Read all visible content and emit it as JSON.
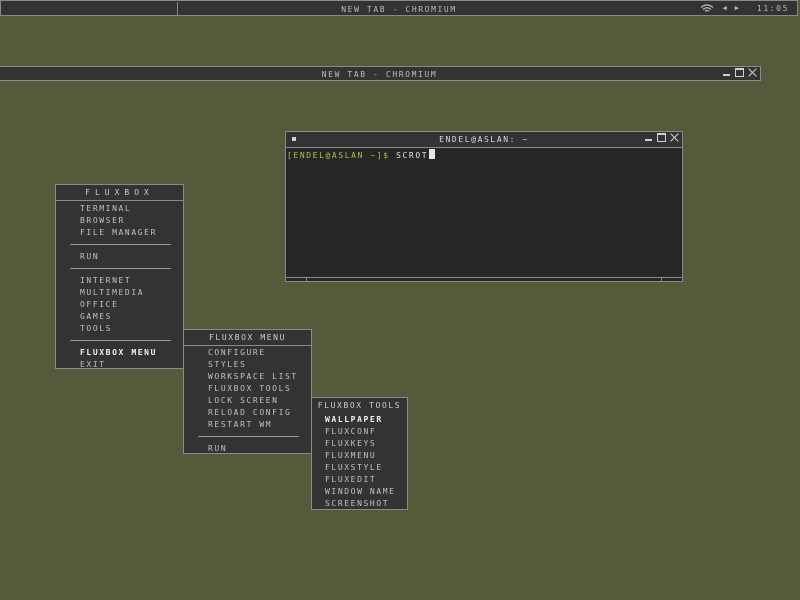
{
  "toolbar": {
    "title": "New Tab - Chromium",
    "clock": "11:05",
    "icons": [
      "wifi-icon",
      "prev-workspace-icon",
      "next-workspace-icon"
    ]
  },
  "chromium": {
    "title": "New Tab - Chromium"
  },
  "terminal": {
    "title": "endel@aslan: ~",
    "prompt": "[endel@aslan ~]$ ",
    "command": "scrot"
  },
  "main_menu": {
    "title": "Fluxbox",
    "items": [
      "Terminal",
      "Browser",
      "File Manager",
      "Run",
      "Internet",
      "Multimedia",
      "Office",
      "Games",
      "Tools",
      "Fluxbox Menu",
      "Exit"
    ]
  },
  "fluxbox_menu": {
    "title": "Fluxbox Menu",
    "items": [
      "Configure",
      "Styles",
      "Workspace List",
      "Fluxbox Tools",
      "Lock Screen",
      "Reload Config",
      "Restart WM",
      "Run"
    ]
  },
  "tools_menu": {
    "title": "Fluxbox Tools",
    "items": [
      "Wallpaper",
      "Fluxconf",
      "Fluxkeys",
      "Fluxmenu",
      "Fluxstyle",
      "Fluxedit",
      "Window Name",
      "Screenshot"
    ]
  },
  "colors": {
    "desktop": "#545a3a",
    "panel": "#333333",
    "border": "#8a8a8a",
    "prompt": "#a7c34a"
  }
}
